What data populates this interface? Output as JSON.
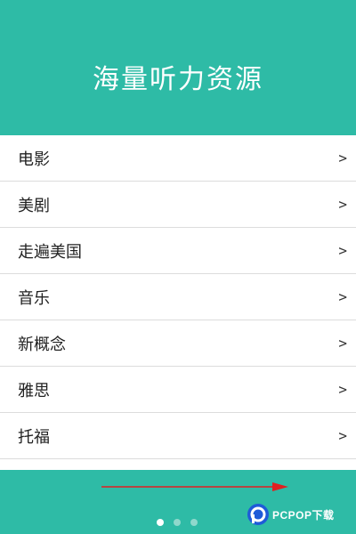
{
  "header": {
    "title": "海量听力资源"
  },
  "list": {
    "chevron": ">",
    "items": [
      {
        "label": "电影"
      },
      {
        "label": "美剧"
      },
      {
        "label": "走遍美国"
      },
      {
        "label": "音乐"
      },
      {
        "label": "新概念"
      },
      {
        "label": "雅思"
      },
      {
        "label": "托福"
      }
    ]
  },
  "pager": {
    "count": 3,
    "active_index": 0
  },
  "colors": {
    "accent": "#2ebba6",
    "arrow": "#e02020",
    "dot_active": "#ffffff",
    "dot_inactive": "#8fd8cc"
  },
  "watermark": {
    "text": "PCPOP下载"
  }
}
